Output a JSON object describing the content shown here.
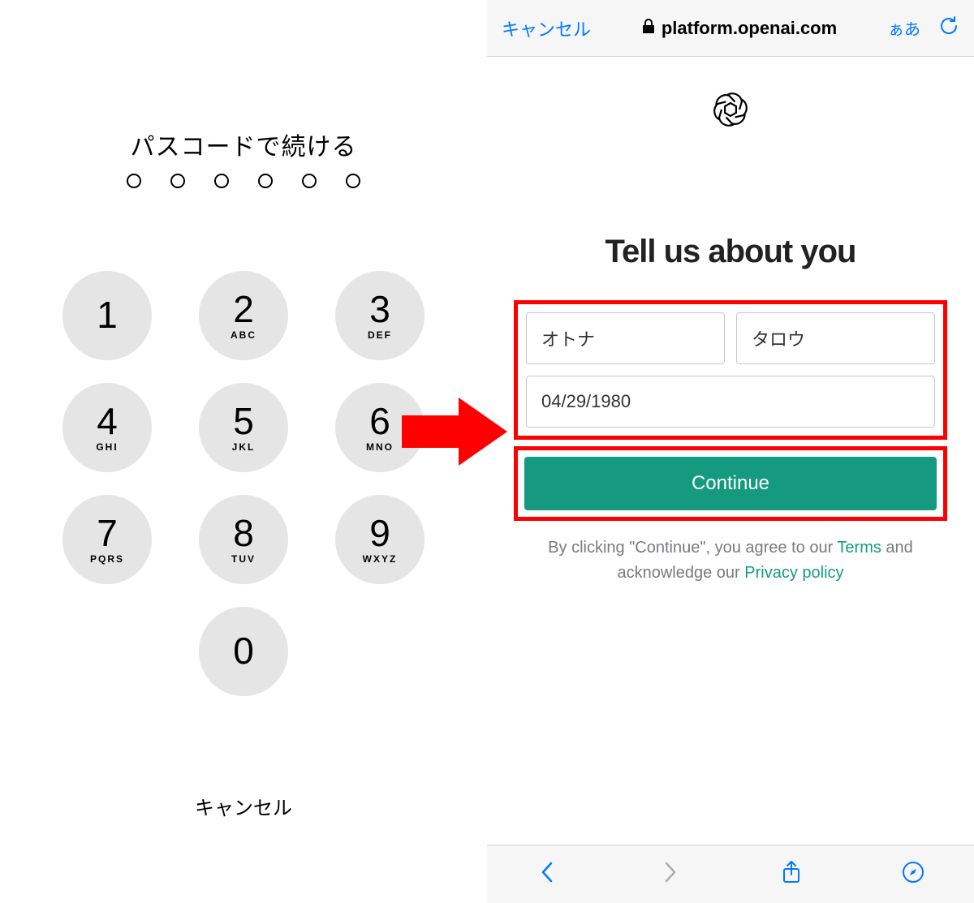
{
  "left": {
    "title": "パスコードで続ける",
    "passcode_length": 6,
    "cancel_label": "キャンセル",
    "keys": [
      {
        "digit": "1",
        "letters": ""
      },
      {
        "digit": "2",
        "letters": "ABC"
      },
      {
        "digit": "3",
        "letters": "DEF"
      },
      {
        "digit": "4",
        "letters": "GHI"
      },
      {
        "digit": "5",
        "letters": "JKL"
      },
      {
        "digit": "6",
        "letters": "MNO"
      },
      {
        "digit": "7",
        "letters": "PQRS"
      },
      {
        "digit": "8",
        "letters": "TUV"
      },
      {
        "digit": "9",
        "letters": "WXYZ"
      },
      {
        "digit": "0",
        "letters": ""
      }
    ]
  },
  "right": {
    "addr_bar": {
      "cancel": "キャンセル",
      "domain": "platform.openai.com",
      "reader": "ぁあ"
    },
    "form": {
      "title": "Tell us about you",
      "first_name": "オトナ",
      "last_name": "タロウ",
      "dob": "04/29/1980",
      "continue_label": "Continue",
      "agree_pre": "By clicking \"Continue\", you agree to our ",
      "terms_label": "Terms",
      "agree_mid": " and acknowledge our ",
      "privacy_label": "Privacy policy"
    }
  },
  "colors": {
    "accent_green": "#159a80",
    "red": "#ff0000",
    "ios_blue": "#007aff"
  }
}
